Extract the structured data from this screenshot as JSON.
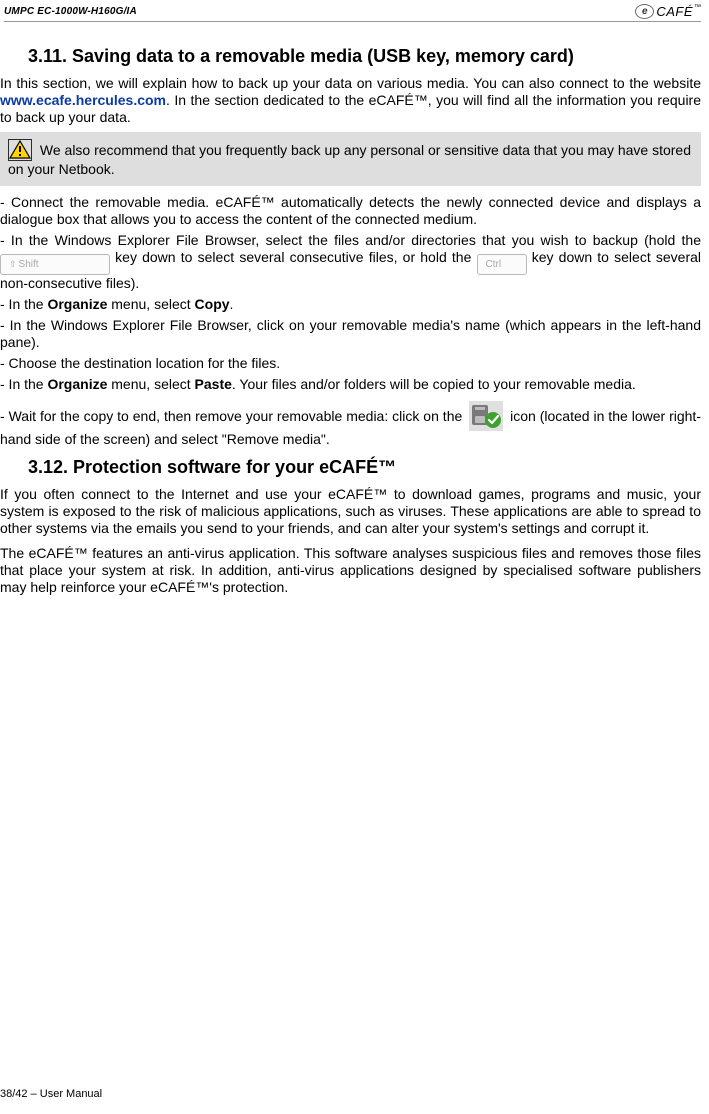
{
  "header": {
    "model": "UMPC EC-1000W-H160G/IA",
    "logo": {
      "mark": "e",
      "word": "CAFÉ",
      "tm": "™"
    }
  },
  "section1": {
    "heading": "3.11. Saving data to a removable media (USB key, memory card)",
    "p1a": "In this section, we will explain how to back up your data on various media. You can also connect to the website ",
    "link": "www.ecafe.hercules.com",
    "p1b": ". In the section dedicated to the eCAFÉ™, you will find all the information you require to back up your data.",
    "callout": " We also recommend that you frequently back up any personal or sensitive data that you may have stored on your Netbook.",
    "p2": "- Connect the removable media. eCAFÉ™ automatically detects the newly connected device and displays a dialogue box that allows you to access the content of the connected medium.",
    "p3a": "- In the Windows Explorer File Browser, select the files and/or directories that you wish to backup (hold the ",
    "shiftKey": "Shift",
    "p3b": " key down to select several consecutive files, or hold the ",
    "ctrlKey": "Ctrl",
    "p3c": " key down to select several non-consecutive files).",
    "p4a": "- In the ",
    "p4b": "Organize",
    "p4c": " menu, select ",
    "p4d": "Copy",
    "p4e": ".",
    "p5": "- In the Windows Explorer File Browser, click on your removable media's name (which appears in the left-hand pane).",
    "p6": "- Choose the destination location for the files.",
    "p7a": "- In the ",
    "p7b": "Organize",
    "p7c": " menu, select ",
    "p7d": "Paste",
    "p7e": ". Your files and/or folders will be copied to your removable media.",
    "p8a": "- Wait for the copy to end, then remove your removable media: click on the ",
    "p8b": " icon (located in the lower right-hand side of the screen) and select \"Remove media\"."
  },
  "section2": {
    "heading": "3.12. Protection software for your eCAFÉ™",
    "p1": "If you often connect to the Internet and use your eCAFÉ™ to download games, programs and music, your system is exposed to the risk of malicious applications, such as viruses. These applications are able to spread to other systems via the emails you send to your friends, and can alter your system's settings and corrupt it.",
    "p2": "The eCAFÉ™ features an anti-virus application. This software analyses suspicious files and removes those files that place your system at risk. In addition, anti-virus applications designed by specialised software publishers may help reinforce your eCAFÉ™'s protection."
  },
  "footer": {
    "pageinfo": "38/42 – User Manual"
  }
}
